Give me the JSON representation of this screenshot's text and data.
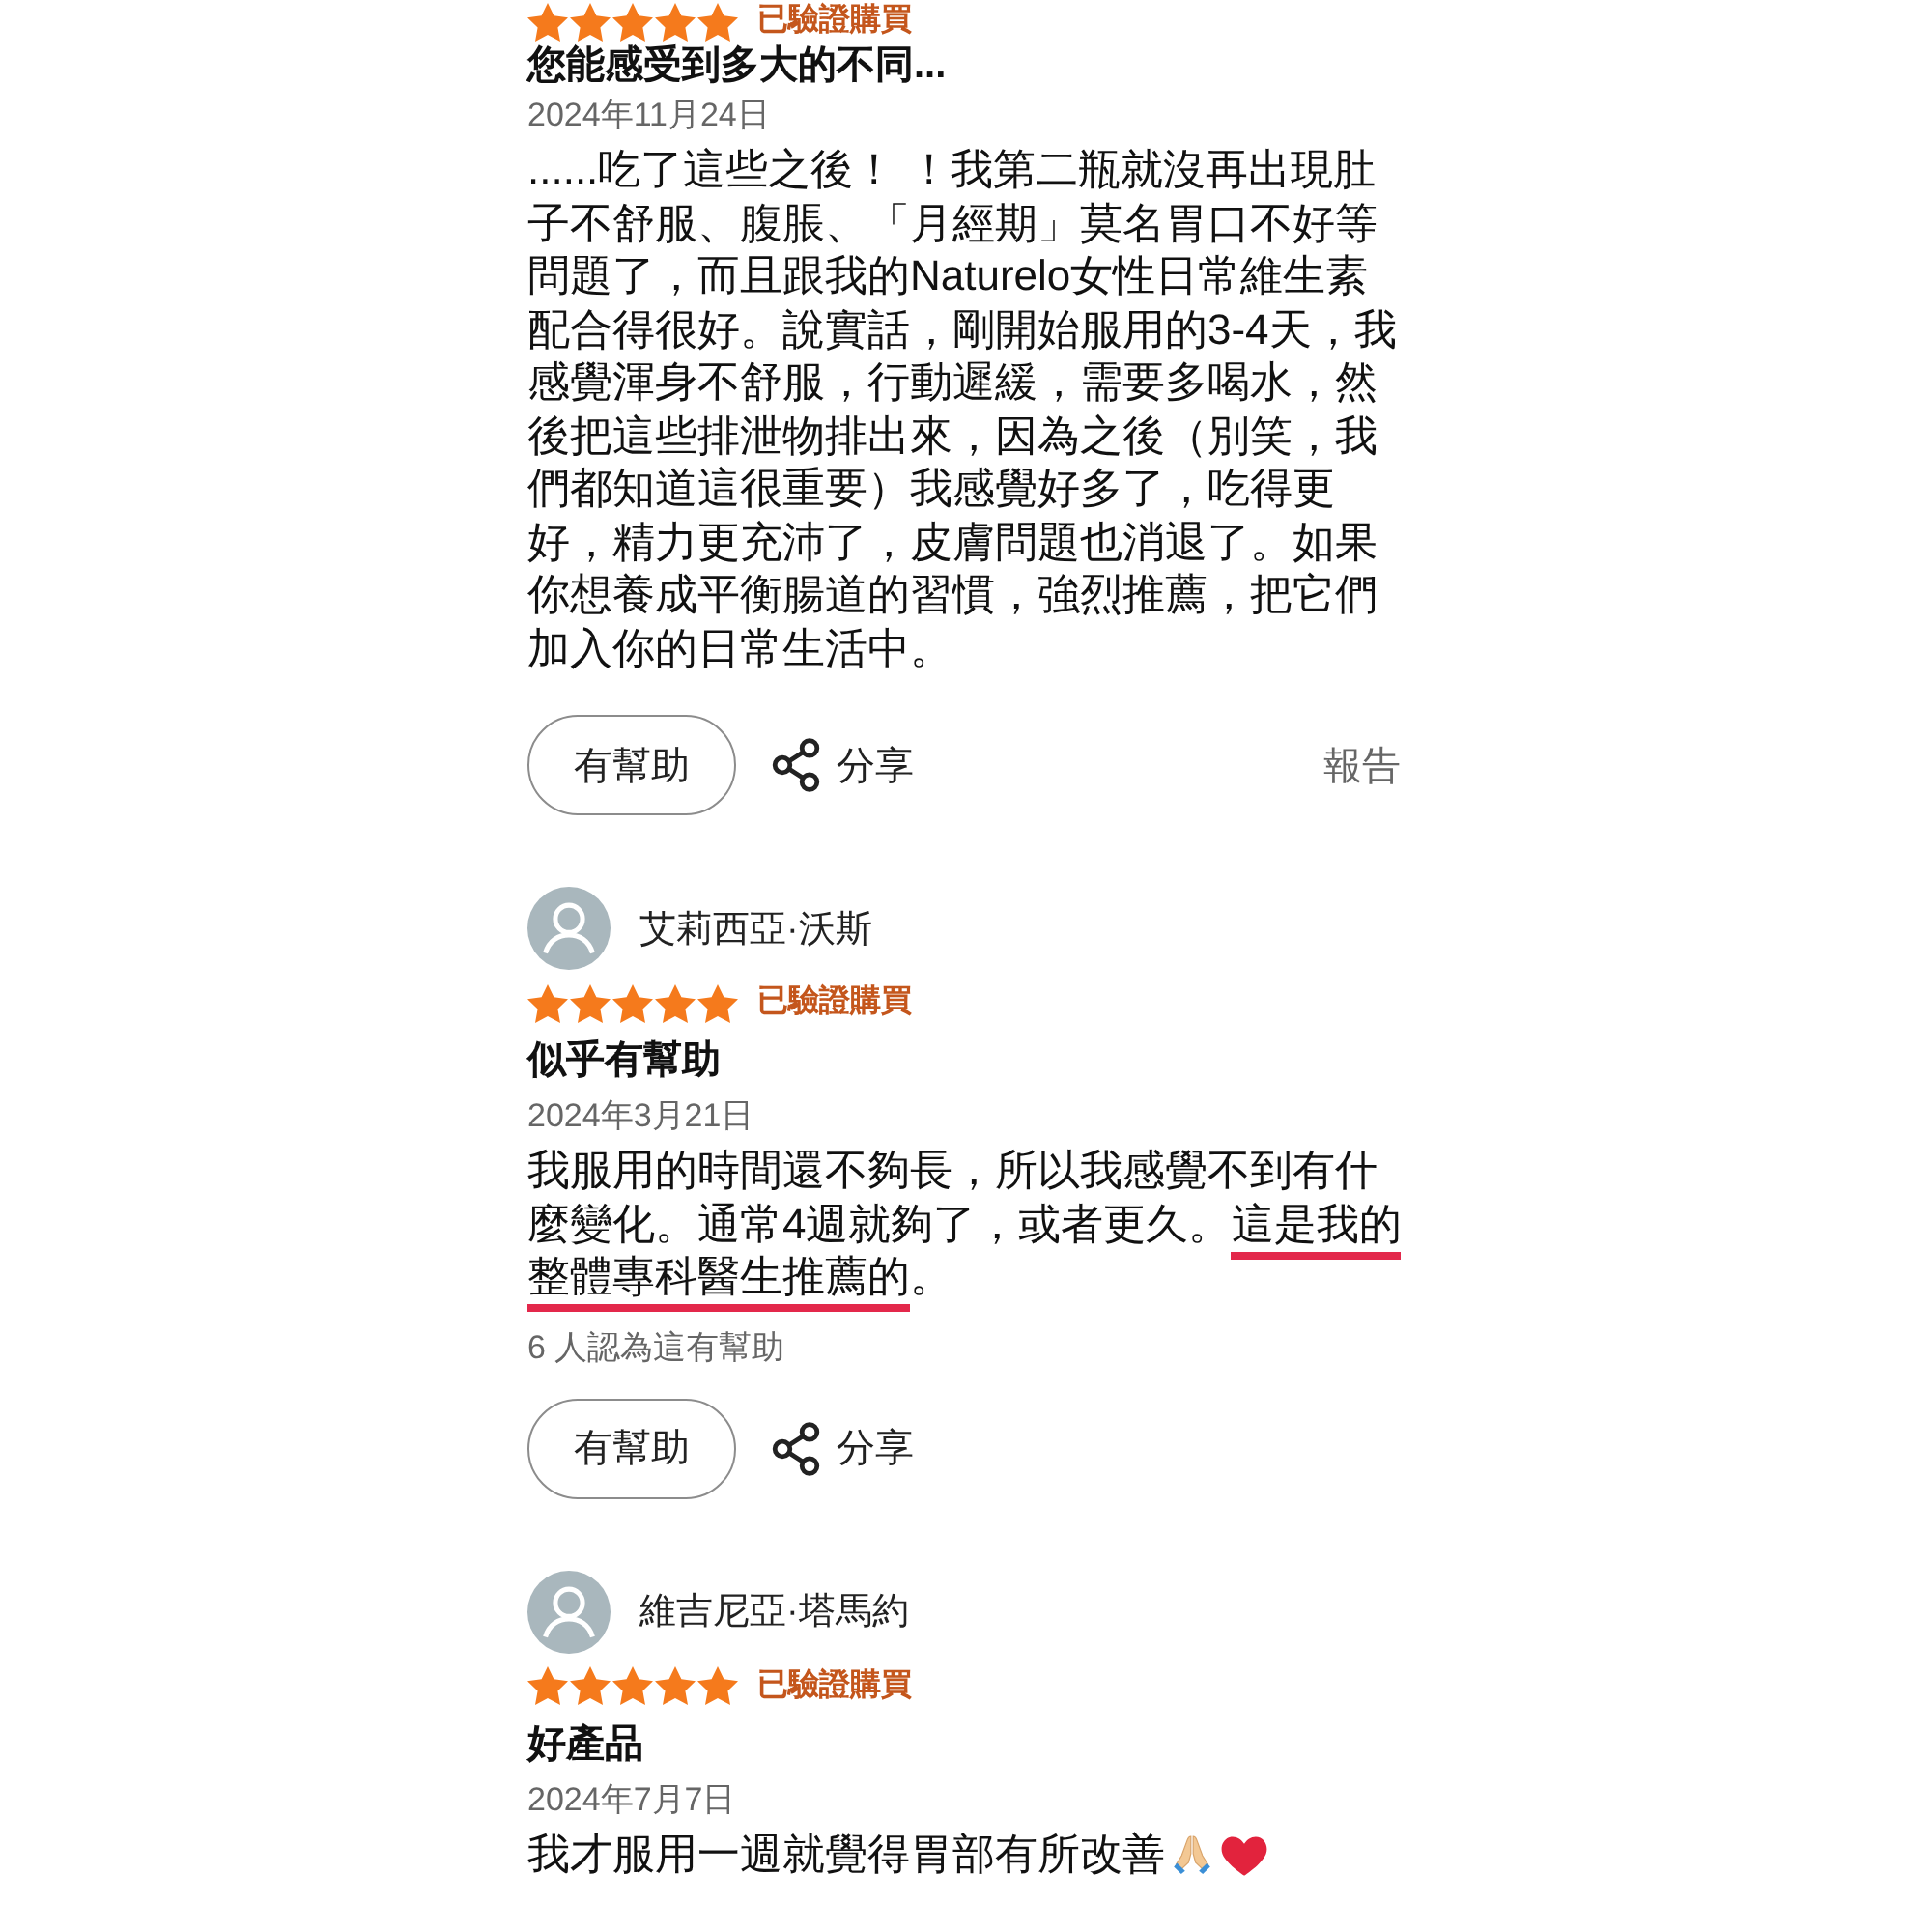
{
  "reviews": [
    {
      "stars": 5,
      "badge": "已驗證購買",
      "title": "您能感受到多大的不同...",
      "date": "2024年11月24日",
      "body": [
        {
          "text": "......吃了這些之後！ ！我第二瓶就沒再出現肚子不舒服、腹脹、「月經期」莫名胃口不好等問題了，而且跟我的Naturelo女性日常維生素配合得很好。說實話，剛開始服用的3-4天，我感覺渾身不舒服，行動遲緩，需要多喝水，然後把這些排泄物排出來，因為之後（別笑，我們都知道這很重要）我感覺好多了，吃得更好，精力更充沛了，皮膚問題也消退了。如果你想養成平衡腸道的習慣，強烈推薦，把它們加入你的日常生活中。",
          "underlined": false
        }
      ],
      "actions": {
        "helpful_button": "有幫助",
        "share_button": "分享",
        "report_link": "報告"
      }
    },
    {
      "reviewer": {
        "name": "艾莉西亞·沃斯"
      },
      "stars": 5,
      "badge": "已驗證購買",
      "title": "似乎有幫助",
      "date": "2024年3月21日",
      "body": [
        {
          "text": "我服用的時間還不夠長，所以我感覺不到有什麼變化。通常4週就夠了，或者更久。",
          "underlined": false
        },
        {
          "text": "這是我的整體專科醫生推薦的",
          "underlined": true
        },
        {
          "text": "。",
          "underlined": false
        }
      ],
      "helpful_count": "6 人認為這有幫助",
      "actions": {
        "helpful_button": "有幫助",
        "share_button": "分享"
      }
    },
    {
      "reviewer": {
        "name": "維吉尼亞·塔馬約"
      },
      "stars": 5,
      "badge": "已驗證購買",
      "title": "好產品",
      "date": "2024年7月7日",
      "body": [
        {
          "text": "我才服用一週就覺得胃部有所改善",
          "underlined": false
        }
      ],
      "body_icons": [
        {
          "kind": "praying-hands"
        },
        {
          "kind": "heart"
        }
      ]
    }
  ]
}
